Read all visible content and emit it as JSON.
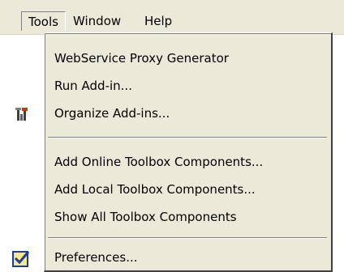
{
  "menubar": {
    "items": [
      {
        "label": "Tools"
      },
      {
        "label": "Window"
      },
      {
        "label": "Help"
      }
    ]
  },
  "menu": {
    "items": [
      {
        "label": "WebService Proxy Generator",
        "icon": null
      },
      {
        "label": "Run Add-in...",
        "icon": null
      },
      {
        "label": "Organize Add-ins...",
        "icon": "tools-icon"
      },
      {
        "label": "Add Online Toolbox Components...",
        "icon": null
      },
      {
        "label": "Add Local Toolbox Components...",
        "icon": null
      },
      {
        "label": "Show All Toolbox Components",
        "icon": null
      },
      {
        "label": "Preferences...",
        "icon": "checkbox-checked-icon"
      }
    ]
  },
  "colors": {
    "menu_bg": "#ece9d8",
    "check_blue": "#1e3c9c",
    "check_yellow": "#f8e88c"
  }
}
